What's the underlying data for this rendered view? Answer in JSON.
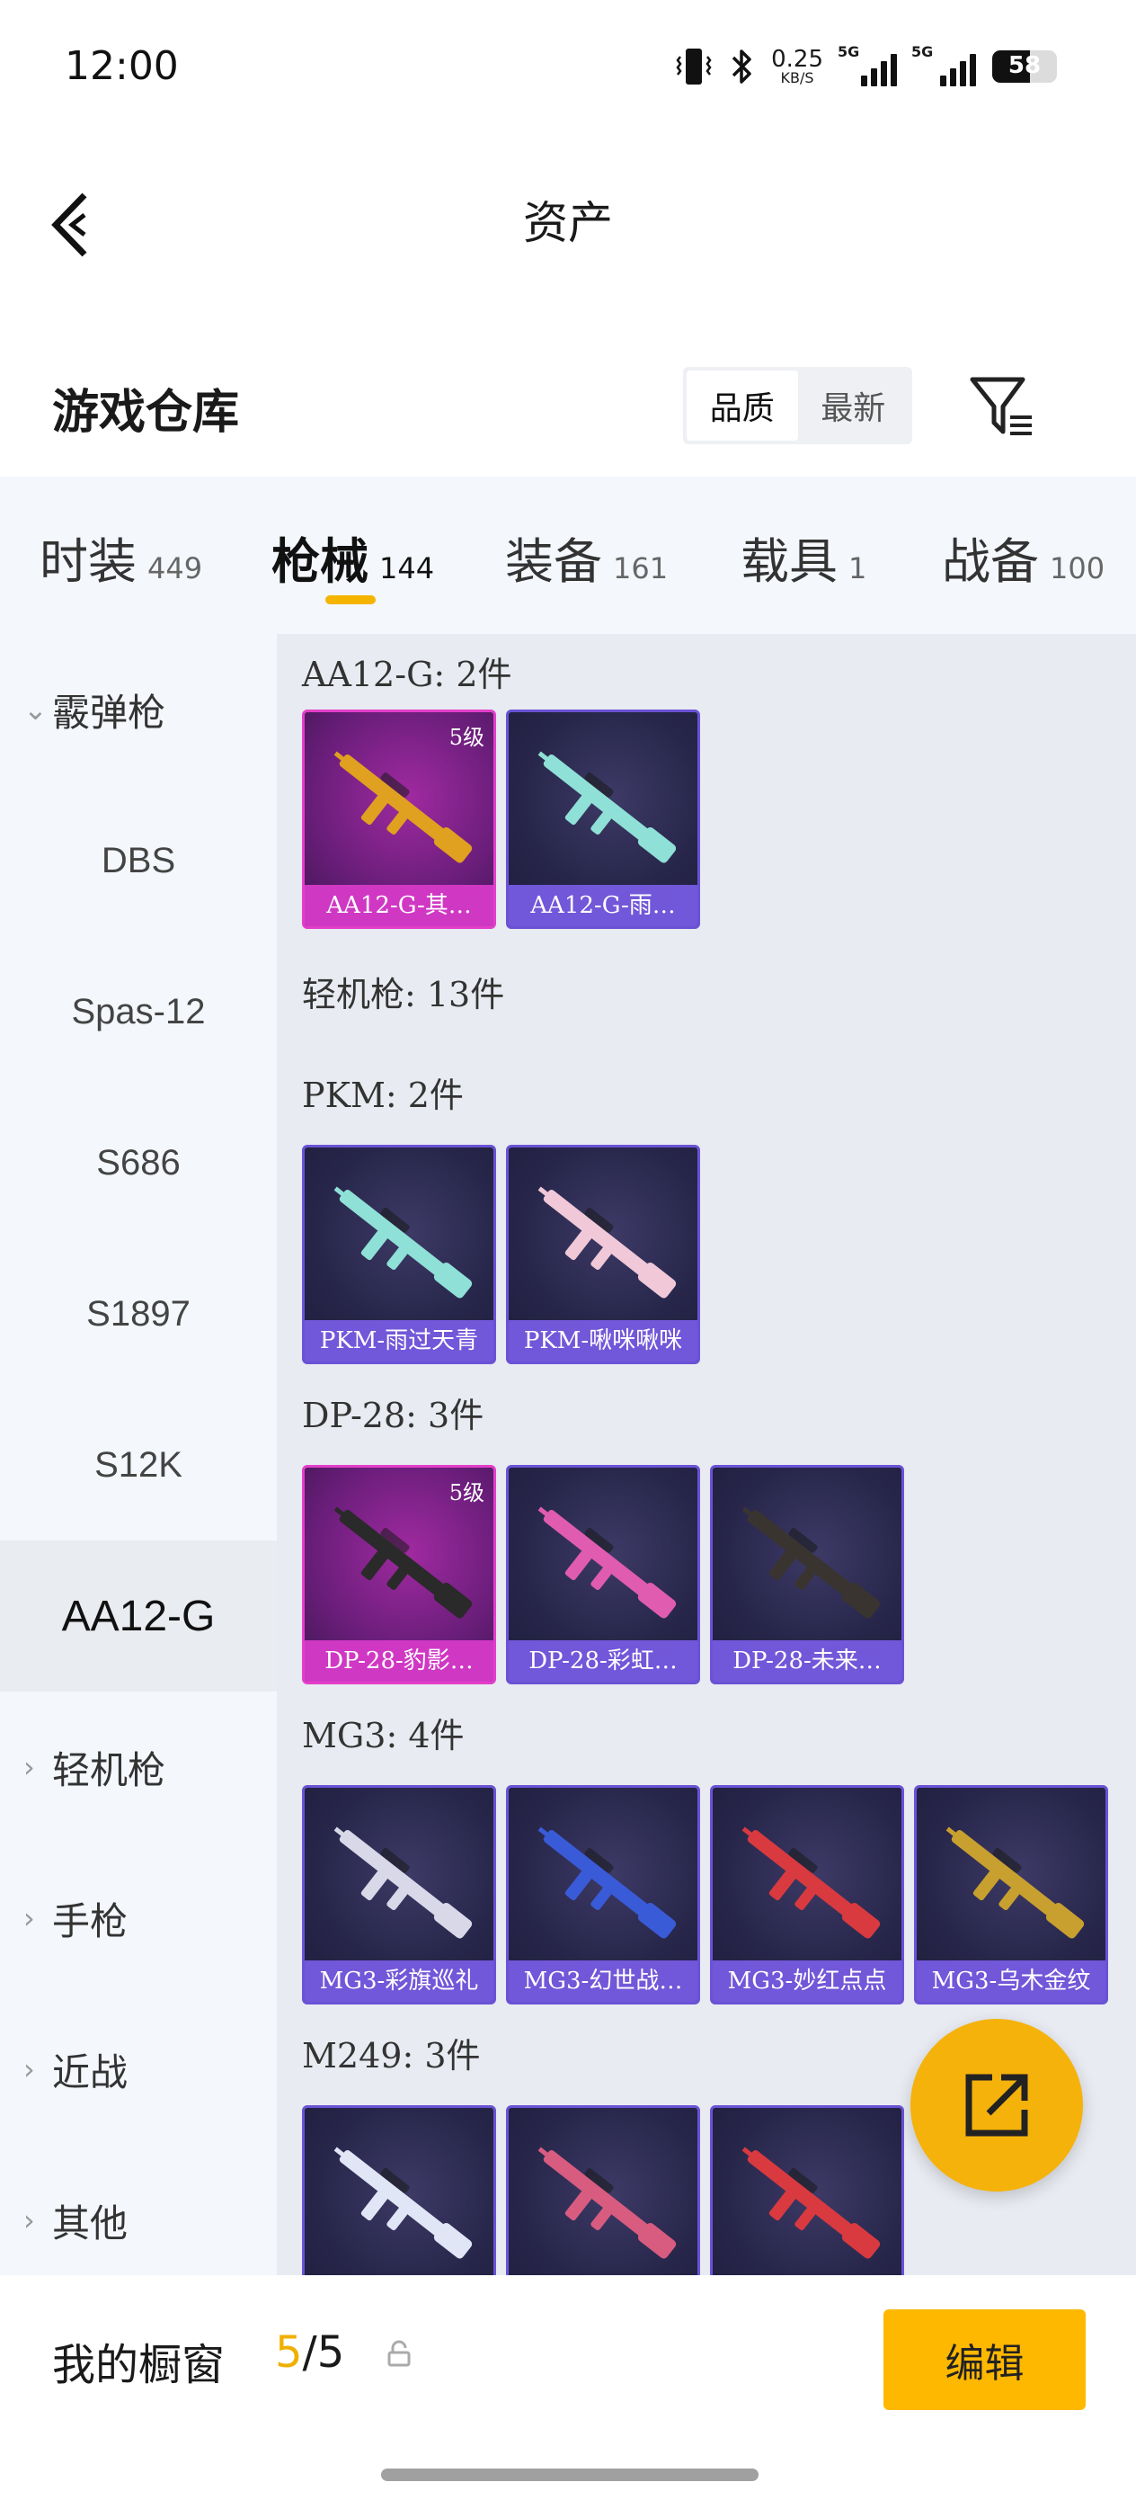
{
  "status_bar": {
    "time": "12:00",
    "net_speed": "0.25",
    "net_unit": "KB/S",
    "signal1_tag": "5G",
    "signal2_tag": "5G",
    "battery": "58"
  },
  "header": {
    "title": "资产"
  },
  "warehouse": {
    "title": "游戏仓库",
    "sort_options": [
      "品质",
      "最新"
    ],
    "sort_selected": "品质"
  },
  "tabs": [
    {
      "label": "时装",
      "count": "449"
    },
    {
      "label": "枪械",
      "count": "144",
      "active": true
    },
    {
      "label": "装备",
      "count": "161"
    },
    {
      "label": "载具",
      "count": "1"
    },
    {
      "label": "战备",
      "count": "100"
    }
  ],
  "sidebar": {
    "items": [
      {
        "label": "霰弹枪",
        "expanded": true
      },
      {
        "label": "DBS"
      },
      {
        "label": "Spas-12"
      },
      {
        "label": "S686"
      },
      {
        "label": "S1897"
      },
      {
        "label": "S12K"
      },
      {
        "label": "AA12-G",
        "selected": true
      },
      {
        "label": "轻机枪"
      },
      {
        "label": "手枪"
      },
      {
        "label": "近战"
      },
      {
        "label": "其他"
      }
    ]
  },
  "content": {
    "groups": [
      {
        "label": "AA12-G: 2件"
      },
      {
        "label": "轻机枪: 13件"
      },
      {
        "label": "PKM: 2件"
      },
      {
        "label": "DP-28: 3件"
      },
      {
        "label": "MG3: 4件"
      },
      {
        "label": "M249: 3件"
      }
    ],
    "cards": [
      {
        "name": "AA12-G-其…",
        "level": "5级",
        "quality": "pink",
        "gun_color": "#e0a020"
      },
      {
        "name": "AA12-G-雨…",
        "quality": "purple",
        "gun_color": "#8fe0d6"
      },
      {
        "name": "PKM-雨过天青",
        "quality": "purple",
        "gun_color": "#8fe0d6"
      },
      {
        "name": "PKM-啾咪啾咪",
        "quality": "purple",
        "gun_color": "#f0c8d8"
      },
      {
        "name": "DP-28-豹影…",
        "level": "5级",
        "quality": "pink",
        "gun_color": "#2a2a2a"
      },
      {
        "name": "DP-28-彩虹…",
        "quality": "purple",
        "gun_color": "#e05cb0"
      },
      {
        "name": "DP-28-未来…",
        "quality": "purple",
        "gun_color": "#3a3430"
      },
      {
        "name": "MG3-彩旗巡礼",
        "quality": "purple",
        "gun_color": "#d8d8e8"
      },
      {
        "name": "MG3-幻世战…",
        "quality": "purple",
        "gun_color": "#3a5bd8"
      },
      {
        "name": "MG3-妙红点点",
        "quality": "purple",
        "gun_color": "#d83a40"
      },
      {
        "name": "MG3-乌木金纹",
        "quality": "purple",
        "gun_color": "#c8a030"
      },
      {
        "name": "",
        "quality": "purple",
        "gun_color": "#e0e6f5"
      },
      {
        "name": "",
        "quality": "purple",
        "gun_color": "#d85c80"
      },
      {
        "name": "",
        "quality": "purple",
        "gun_color": "#d83a40"
      }
    ]
  },
  "showcase": {
    "label": "我的橱窗",
    "current": "5",
    "total": "/5",
    "edit_label": "编辑"
  }
}
